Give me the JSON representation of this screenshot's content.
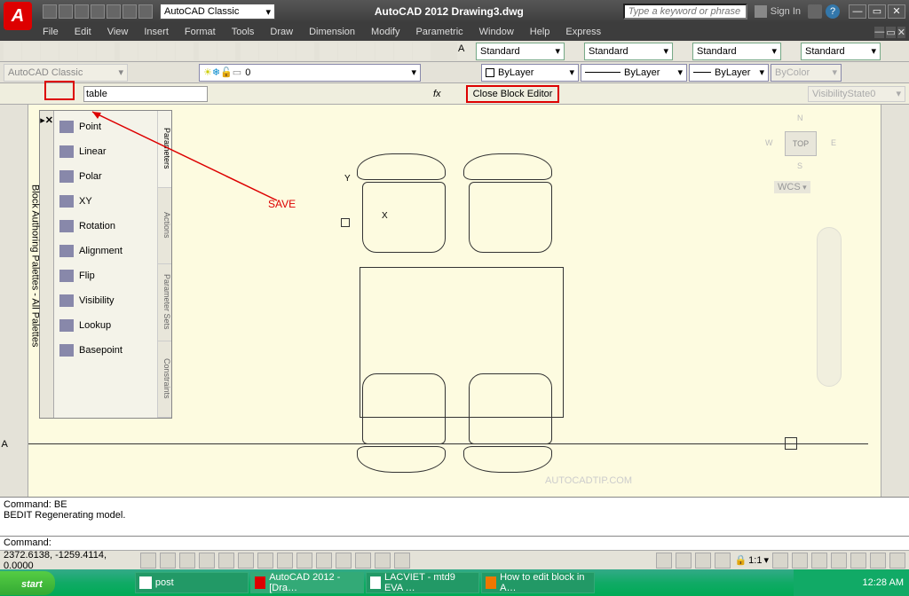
{
  "title": "AutoCAD 2012   Drawing3.dwg",
  "workspace": "AutoCAD Classic",
  "search_placeholder": "Type a keyword or phrase",
  "signin": "Sign In",
  "menu": [
    "File",
    "Edit",
    "View",
    "Insert",
    "Format",
    "Tools",
    "Draw",
    "Dimension",
    "Modify",
    "Parametric",
    "Window",
    "Help",
    "Express"
  ],
  "style_bar": {
    "standard": "Standard"
  },
  "layer_bar": {
    "ws": "AutoCAD Classic",
    "layer": "0",
    "bylayer": "ByLayer",
    "bycolor": "ByColor"
  },
  "block_toolbar": {
    "name": "table",
    "close": "Close Block Editor",
    "vis": "VisibilityState0"
  },
  "palette": {
    "title": "Block Authoring Palettes - All Palettes",
    "items": [
      "Point",
      "Linear",
      "Polar",
      "XY",
      "Rotation",
      "Alignment",
      "Flip",
      "Visibility",
      "Lookup",
      "Basepoint"
    ],
    "tabs": [
      "Parameters",
      "Actions",
      "Parameter Sets",
      "Constraints"
    ]
  },
  "annotation": {
    "save": "SAVE"
  },
  "axes": {
    "y": "Y",
    "x": "X"
  },
  "viewcube": {
    "top": "TOP",
    "n": "N",
    "s": "S",
    "e": "E",
    "w": "W",
    "wcs": "WCS"
  },
  "watermark": "AUTOCADTIP.COM",
  "command": {
    "line1": "Command: BE",
    "line2": "BEDIT Regenerating model.",
    "prompt": "Command:"
  },
  "status": {
    "coords": "2372.6138, -1259.4114, 0.0000",
    "scale": "1:1"
  },
  "taskbar": {
    "start": "start",
    "tasks": [
      {
        "label": "post"
      },
      {
        "label": "AutoCAD 2012 - [Dra…"
      },
      {
        "label": "LACVIET - mtd9 EVA …"
      },
      {
        "label": "How to edit block in A…"
      }
    ],
    "time": "12:28 AM"
  }
}
